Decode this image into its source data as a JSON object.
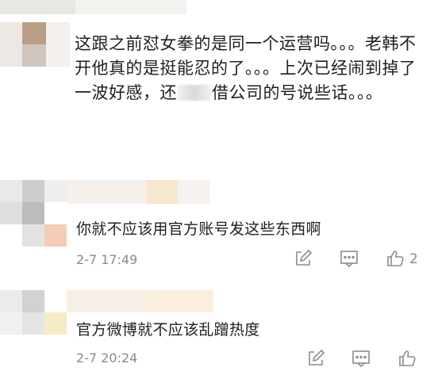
{
  "comments": [
    {
      "text_before": "这跟之前怼女拳的是同一个运营吗。。。老韩不开他真的是挺能忍的了。。。上次已经闹到掉了一波好感，还",
      "text_after": "借公司的号说些话。。。",
      "avatar_colors": [
        "#c8b7a6",
        "#d9d2cb",
        "#b9b2ad",
        "#e2dcd7",
        "#eee9e4"
      ]
    },
    {
      "text": "你就不应该用官方账号发这些东西啊",
      "time": "2-7 17:49",
      "likes": "2",
      "icons": [
        "edit-icon",
        "comment-icon",
        "thumbs-up-icon"
      ],
      "avatar_colors": [
        "#d8d8d8",
        "#c9c9c9",
        "#ececec",
        "#bdbdbd",
        "#f3d1bd"
      ]
    },
    {
      "text": "官方微博就不应该乱蹭热度",
      "time": "2-7 20:24",
      "likes": "",
      "icons": [
        "edit-icon",
        "comment-icon",
        "thumbs-up-icon"
      ],
      "avatar_colors": [
        "#d5d5d5",
        "#e8e8e8",
        "#cfcfcf",
        "#f5e9c6",
        "#ededed"
      ]
    }
  ],
  "colors": {
    "text": "#1f1f1f",
    "meta": "#8a8a8a",
    "icon": "#8c8c8c"
  }
}
